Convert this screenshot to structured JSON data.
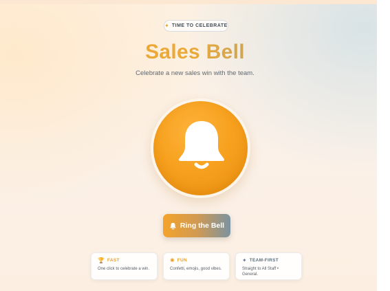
{
  "badge": {
    "icon": "party-popper-icon",
    "text": "TIME TO CELEBRATE"
  },
  "title": "Sales Bell",
  "subtitle": "Celebrate a new sales win with the team.",
  "bell": {
    "icon": "bell-icon"
  },
  "ring_button": {
    "icon": "bell-icon",
    "label": "Ring the Bell"
  },
  "cards": [
    {
      "icon": "trophy-icon",
      "title": "FAST",
      "description": "One click to celebrate a win.",
      "accent": "#e8a020"
    },
    {
      "icon": "confetti-icon",
      "title": "FUN",
      "description": "Confetti, emojis, good vibes.",
      "accent": "#e8a020"
    },
    {
      "icon": "sparkle-icon",
      "title": "TEAM-FIRST",
      "description": "Straight to All Staff • General.",
      "accent": "#5a6f7c"
    }
  ],
  "colors": {
    "accent_orange": "#f7a11f",
    "accent_slate": "#7b93a0"
  }
}
